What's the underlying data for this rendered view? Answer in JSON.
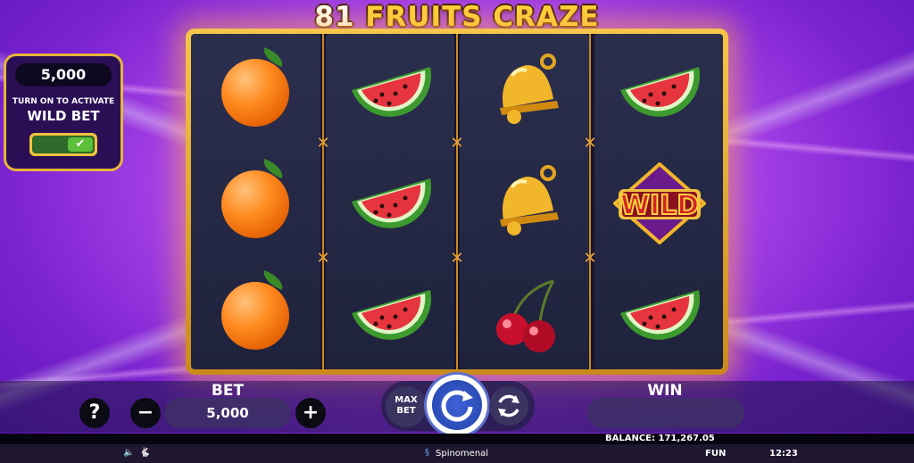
{
  "game": {
    "title_number": "81",
    "title_text": "FRUITS CRAZE"
  },
  "wild_panel": {
    "amount": "5,000",
    "line1": "TURN ON TO ACTIVATE",
    "line2": "WILD BET",
    "toggle_state": "on"
  },
  "reels": [
    [
      "orange-icon",
      "orange-icon",
      "orange-icon"
    ],
    [
      "watermelon-icon",
      "watermelon-icon",
      "watermelon-icon"
    ],
    [
      "bell-icon",
      "bell-icon",
      "cherry-icon"
    ],
    [
      "watermelon-icon",
      "wild-icon",
      "watermelon-icon"
    ]
  ],
  "wild_label": "WILD",
  "controls": {
    "help": "?",
    "bet_label": "BET",
    "minus": "−",
    "bet_value": "5,000",
    "plus": "+",
    "max_bet": "MAX BET",
    "win_label": "WIN",
    "win_value": ""
  },
  "status": {
    "balance": "BALANCE: 171,267.05",
    "mode": "FUN",
    "time": "12:23"
  },
  "footer": {
    "brand": "Spinomenal"
  }
}
